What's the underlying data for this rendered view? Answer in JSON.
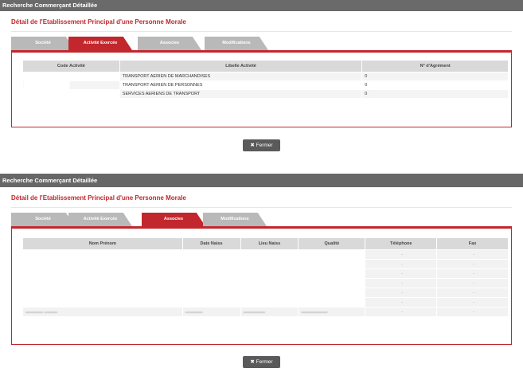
{
  "panel1": {
    "window_title": "Recherche Commerçant Détaillée",
    "subtitle": "Détail de l'Etablissement Principal d'une Personne Morale",
    "tabs": [
      "Société",
      "Activité Exercée",
      "Associes",
      "Modifications"
    ],
    "active_tab": "Activité Exercée",
    "table": {
      "headers": [
        "Code Activité",
        "Libelle Activité",
        "N° d'Agrément"
      ],
      "rows": [
        {
          "code": "",
          "libelle": "TRANSPORT AERIEN DE MARCHANDISES",
          "agrement": "0"
        },
        {
          "code": "",
          "libelle": "TRANSPORT AERIEN DE PERSONNES",
          "agrement": "0"
        },
        {
          "code": "",
          "libelle": "SERVICES AERIENS DE TRANSPORT",
          "agrement": "0"
        }
      ]
    },
    "close_label": "✖ Fermer"
  },
  "panel2": {
    "window_title": "Recherche Commerçant Détaillée",
    "subtitle": "Détail de l'Etablissement Principal d'une Personne Morale",
    "tabs": [
      "Société",
      "Activité Exercée",
      "Associes",
      "Modifications"
    ],
    "active_tab": "Associes",
    "table": {
      "headers": [
        "Nom Prénom",
        "Date Naiss",
        "Lieu Naiss",
        "Qualité",
        "Téléphone",
        "Fax"
      ],
      "rows": [
        {
          "telephone": "-",
          "fax": "-"
        },
        {
          "telephone": "-",
          "fax": "-"
        },
        {
          "telephone": "-",
          "fax": "-"
        },
        {
          "telephone": "-",
          "fax": "-"
        },
        {
          "telephone": "-",
          "fax": "-"
        },
        {
          "telephone": "-",
          "fax": "-"
        },
        {
          "telephone": "-",
          "fax": "-"
        }
      ]
    },
    "close_label": "✖ Fermer"
  },
  "colors": {
    "accent": "#c1272d",
    "titlebar": "#6a6a6a",
    "tab_inactive": "#b9b9b9",
    "header_bg": "#d9d9d9",
    "button": "#5a5a5a"
  }
}
